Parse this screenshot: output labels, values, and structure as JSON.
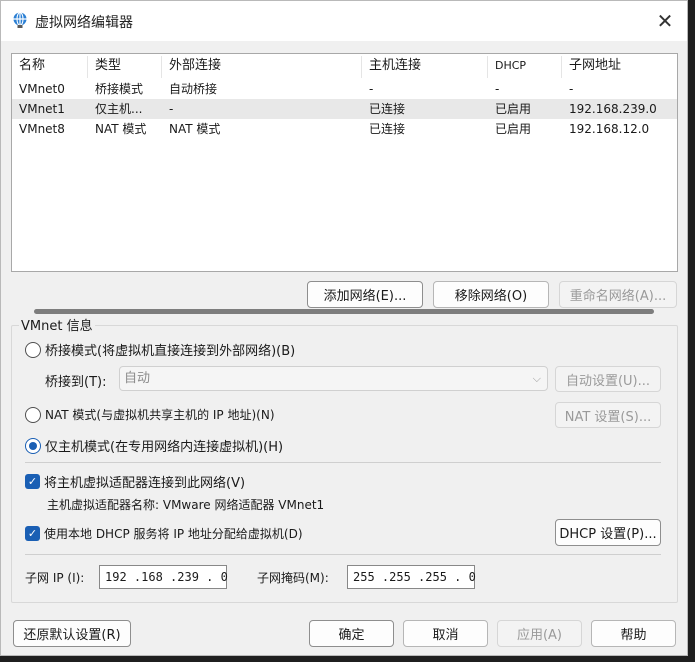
{
  "window": {
    "title": "虚拟网络编辑器",
    "close_glyph": "✕"
  },
  "table": {
    "columns": [
      "名称",
      "类型",
      "外部连接",
      "主机连接",
      "DHCP",
      "子网地址"
    ],
    "rows": [
      {
        "name": "VMnet0",
        "type": "桥接模式",
        "external": "自动桥接",
        "host": "-",
        "dhcp": "-",
        "subnet": "-"
      },
      {
        "name": "VMnet1",
        "type": "仅主机...",
        "external": "-",
        "host": "已连接",
        "dhcp": "已启用",
        "subnet": "192.168.239.0"
      },
      {
        "name": "VMnet8",
        "type": "NAT 模式",
        "external": "NAT 模式",
        "host": "已连接",
        "dhcp": "已启用",
        "subnet": "192.168.12.0"
      }
    ],
    "selected_row": 1
  },
  "table_buttons": {
    "add": "添加网络(E)...",
    "remove": "移除网络(O)",
    "rename": "重命名网络(A)..."
  },
  "vmnet_info": {
    "title": "VMnet 信息",
    "bridged_label": "桥接模式(将虚拟机直接连接到外部网络)(B)",
    "bridge_to_label": "桥接到(T):",
    "bridge_to_value": "自动",
    "auto_settings": "自动设置(U)...",
    "nat_label": "NAT 模式(与虚拟机共享主机的 IP 地址)(N)",
    "nat_settings": "NAT 设置(S)...",
    "hostonly_label": "仅主机模式(在专用网络内连接虚拟机)(H)",
    "selected_mode": "host-only",
    "connect_adapter_label": "将主机虚拟适配器连接到此网络(V)",
    "connect_adapter_checked": true,
    "adapter_name_text": "主机虚拟适配器名称: VMware 网络适配器 VMnet1",
    "dhcp_label": "使用本地 DHCP 服务将 IP 地址分配给虚拟机(D)",
    "dhcp_checked": true,
    "dhcp_settings": "DHCP 设置(P)...",
    "subnet_ip_label": "子网 IP (I):",
    "subnet_ip_value": "192 .168 .239 . 0",
    "subnet_mask_label": "子网掩码(M):",
    "subnet_mask_value": "255 .255 .255 . 0"
  },
  "footer": {
    "restore": "还原默认设置(R)",
    "ok": "确定",
    "cancel": "取消",
    "apply": "应用(A)",
    "help": "帮助"
  },
  "colors": {
    "accent": "#1a5fb4",
    "selected_row": "#e8e8e8"
  }
}
